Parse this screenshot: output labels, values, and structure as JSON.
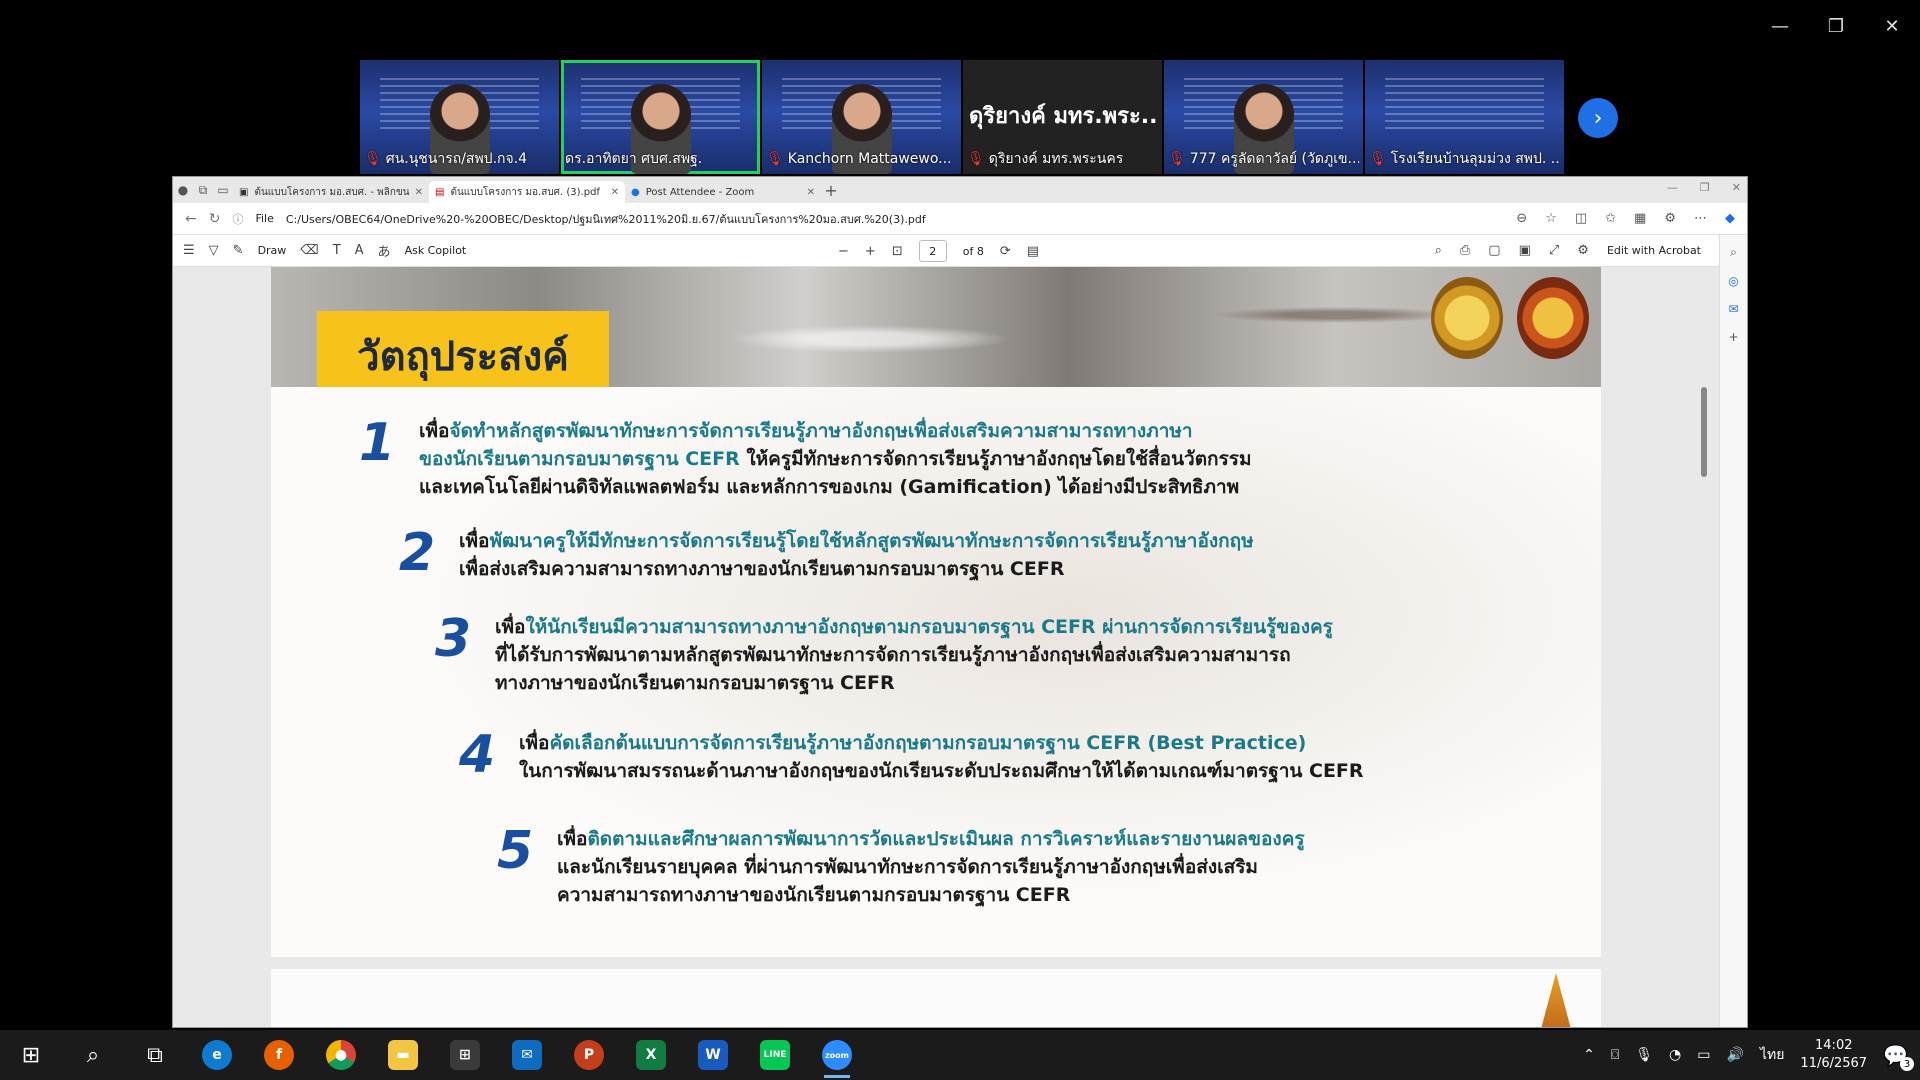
{
  "window_controls": {
    "minimize": "—",
    "restore": "❐",
    "close": "✕"
  },
  "participants": [
    {
      "name": "ศน.นุชนารถ/สพป.กจ.4",
      "type": "video"
    },
    {
      "name": "ดร.อาทิตยา ศบศ.สพฐ.",
      "type": "video",
      "active": true
    },
    {
      "name": "Kanchorn Mattawewo...",
      "type": "video"
    },
    {
      "name": "ดุริยางค์ มทร.พระนคร",
      "type": "name",
      "display": "ดุริยางค์ มทร.พระ..."
    },
    {
      "name": "777 ครูลัดดาวัลย์ (วัดภูเข...",
      "type": "video"
    },
    {
      "name": "โรงเรียนบ้านลุมม่วง สพป. ...",
      "type": "video"
    }
  ],
  "next_page": "›",
  "browser": {
    "tabs": [
      {
        "title": "ต้นแบบโครงการ มอ.สบศ. - พลิกขนาดเล็ก",
        "icon": "▣"
      },
      {
        "title": "ต้นแบบโครงการ มอ.สบศ. (3).pdf",
        "icon": "▤",
        "selected": true
      },
      {
        "title": "Post Attendee - Zoom",
        "icon": "●"
      }
    ],
    "new_tab": "+",
    "address": {
      "scheme": "File",
      "url": "C:/Users/OBEC64/OneDrive%20-%20OBEC/Desktop/ปฐมนิเทศ%2011%20มิ.ย.67/ต้นแบบโครงการ%20มอ.สบศ.%20(3).pdf"
    },
    "pdf_toolbar": {
      "draw": "Draw",
      "ask_copilot": "Ask Copilot",
      "page_current": "2",
      "page_total": "of 8",
      "edit_acrobat": "Edit with Acrobat"
    }
  },
  "slide": {
    "title": "วัตถุประสงค์",
    "objectives": [
      {
        "num": "1",
        "lines": [
          {
            "pre": "เพื่อ",
            "hl": "จัดทำหลักสูตรพัฒนาทักษะการจัดการเรียนรู้ภาษาอังกฤษเพื่อส่งเสริมความสามารถทางภาษา"
          },
          {
            "pre": "",
            "hl": "ของนักเรียนตามกรอบมาตรฐาน CEFR",
            "post": " ให้ครูมีทักษะการจัดการเรียนรู้ภาษาอังกฤษโดยใช้สื่อนวัตกรรม"
          },
          {
            "pre": "และเทคโนโลยีผ่านดิจิทัลแพลตฟอร์ม และหลักการของเกม (Gamification) ได้อย่างมีประสิทธิภาพ",
            "hl": ""
          }
        ]
      },
      {
        "num": "2",
        "lines": [
          {
            "pre": "เพื่อ",
            "hl": "พัฒนาครูให้มีทักษะการจัดการเรียนรู้โดยใช้หลักสูตรพัฒนาทักษะการจัดการเรียนรู้ภาษาอังกฤษ"
          },
          {
            "pre": "เพื่อส่งเสริมความสามารถทางภาษาของนักเรียนตามกรอบมาตรฐาน CEFR",
            "hl": ""
          }
        ]
      },
      {
        "num": "3",
        "lines": [
          {
            "pre": "เพื่อ",
            "hl": "ให้นักเรียนมีความสามารถทางภาษาอังกฤษตามกรอบมาตรฐาน CEFR ผ่านการจัดการเรียนรู้ของครู"
          },
          {
            "pre": "ที่ได้รับการพัฒนาตามหลักสูตรพัฒนาทักษะการจัดการเรียนรู้ภาษาอังกฤษเพื่อส่งเสริมความสามารถ",
            "hl": ""
          },
          {
            "pre": "ทางภาษาของนักเรียนตามกรอบมาตรฐาน CEFR",
            "hl": ""
          }
        ]
      },
      {
        "num": "4",
        "lines": [
          {
            "pre": "เพื่อ",
            "hl": "คัดเลือกต้นแบบการจัดการเรียนรู้ภาษาอังกฤษตามกรอบมาตรฐาน CEFR (Best Practice)"
          },
          {
            "pre": "ในการพัฒนาสมรรถนะด้านภาษาอังกฤษของนักเรียนระดับประถมศึกษาให้ได้ตามเกณฑ์มาตรฐาน CEFR",
            "hl": ""
          }
        ]
      },
      {
        "num": "5",
        "lines": [
          {
            "pre": "เพื่อ",
            "hl": "ติดตามและศึกษาผลการพัฒนาการวัดและประเมินผล การวิเคราะห์และรายงานผลของครู"
          },
          {
            "pre": "และนักเรียนรายบุคคล ที่ผ่านการพัฒนาทักษะการจัดการเรียนรู้ภาษาอังกฤษเพื่อส่งเสริม",
            "hl": ""
          },
          {
            "pre": "ความสามารถทางภาษาของนักเรียนตามกรอบมาตรฐาน CEFR",
            "hl": ""
          }
        ]
      }
    ]
  },
  "taskbar": {
    "apps": [
      "start",
      "search",
      "task-view",
      "edge",
      "firefox",
      "chrome",
      "file-explorer",
      "store",
      "mail",
      "powerpoint",
      "excel",
      "word",
      "line",
      "zoom"
    ],
    "language": "ไทย",
    "time": "14:02",
    "date": "11/6/2567",
    "notifications": "3"
  },
  "colors": {
    "accent": "#1b7a8a",
    "number": "#1a4fa0",
    "title_bg": "#f7c21a",
    "zoom_active": "#20d060"
  }
}
